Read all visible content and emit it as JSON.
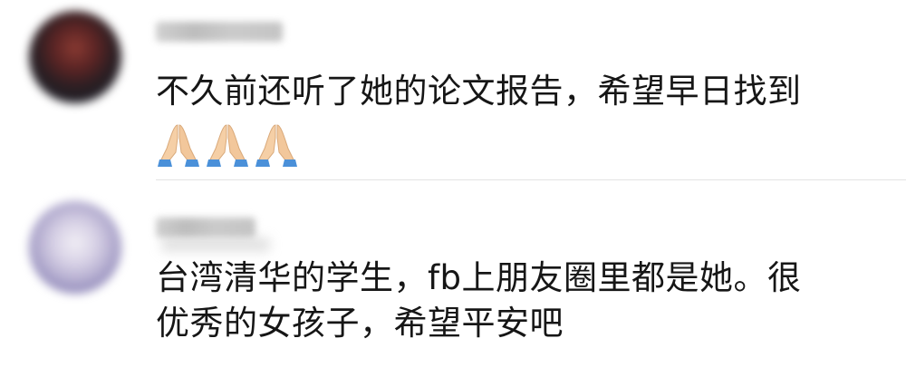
{
  "comments": [
    {
      "username": "",
      "text": "不久前还听了她的论文报告，希望早日找到",
      "emojis": [
        "folded-hands",
        "folded-hands",
        "folded-hands"
      ]
    },
    {
      "username": "",
      "text_lines": [
        "台湾清华的学生，fb上朋友圈里都是她。很",
        "优秀的女孩子，希望平安吧"
      ]
    }
  ]
}
